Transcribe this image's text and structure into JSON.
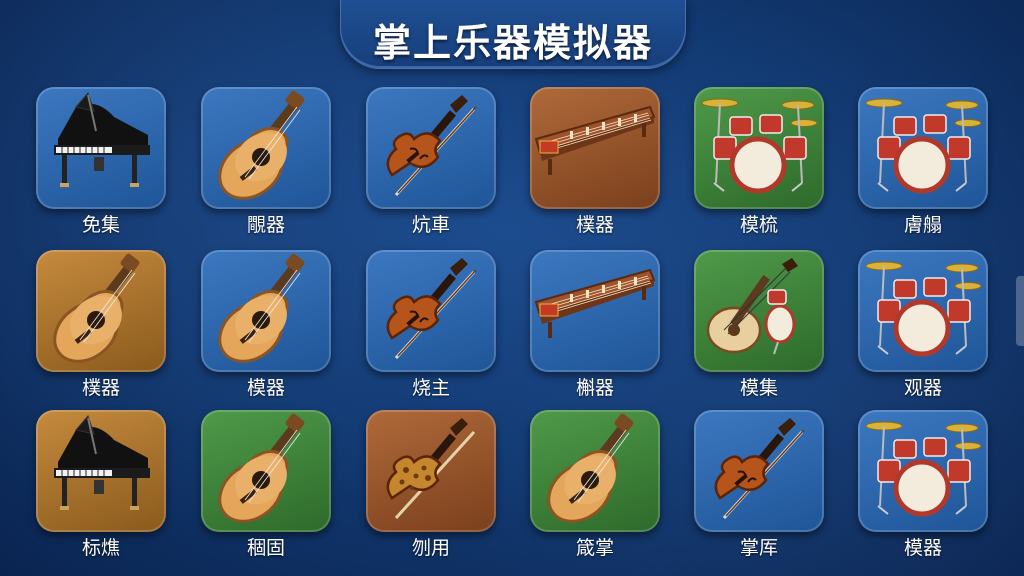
{
  "title": "掌上乐器模拟器",
  "rows": [
    [
      {
        "label": "免集",
        "icon": "grand-piano-icon",
        "bg": "blue"
      },
      {
        "label": "覸器",
        "icon": "acoustic-guitar-icon",
        "bg": "blue"
      },
      {
        "label": "炕車",
        "icon": "violin-icon",
        "bg": "blue"
      },
      {
        "label": "樸器",
        "icon": "guzheng-icon",
        "bg": "wood"
      },
      {
        "label": "模梳",
        "icon": "drum-kit-icon",
        "bg": "green"
      },
      {
        "label": "膚䑽",
        "icon": "drum-kit-icon",
        "bg": "blue"
      }
    ],
    [
      {
        "label": "樸器",
        "icon": "acoustic-guitar-icon",
        "bg": "amber"
      },
      {
        "label": "模器",
        "icon": "acoustic-guitar-icon",
        "bg": "blue"
      },
      {
        "label": "烧主",
        "icon": "violin-icon",
        "bg": "blue"
      },
      {
        "label": "槲器",
        "icon": "guzheng-icon",
        "bg": "blue"
      },
      {
        "label": "模集",
        "icon": "lute-icon",
        "bg": "green"
      },
      {
        "label": "观器",
        "icon": "drum-kit-icon",
        "bg": "blue"
      }
    ],
    [
      {
        "label": "标燋",
        "icon": "grand-piano-icon",
        "bg": "amber"
      },
      {
        "label": "稒固",
        "icon": "acoustic-guitar-icon",
        "bg": "green"
      },
      {
        "label": "刎用",
        "icon": "ornate-violin-icon",
        "bg": "wood"
      },
      {
        "label": "箴掌",
        "icon": "acoustic-guitar-icon",
        "bg": "green"
      },
      {
        "label": "掌厍",
        "icon": "violin-icon",
        "bg": "blue"
      },
      {
        "label": "模器",
        "icon": "drum-kit-icon",
        "bg": "blue"
      }
    ]
  ]
}
